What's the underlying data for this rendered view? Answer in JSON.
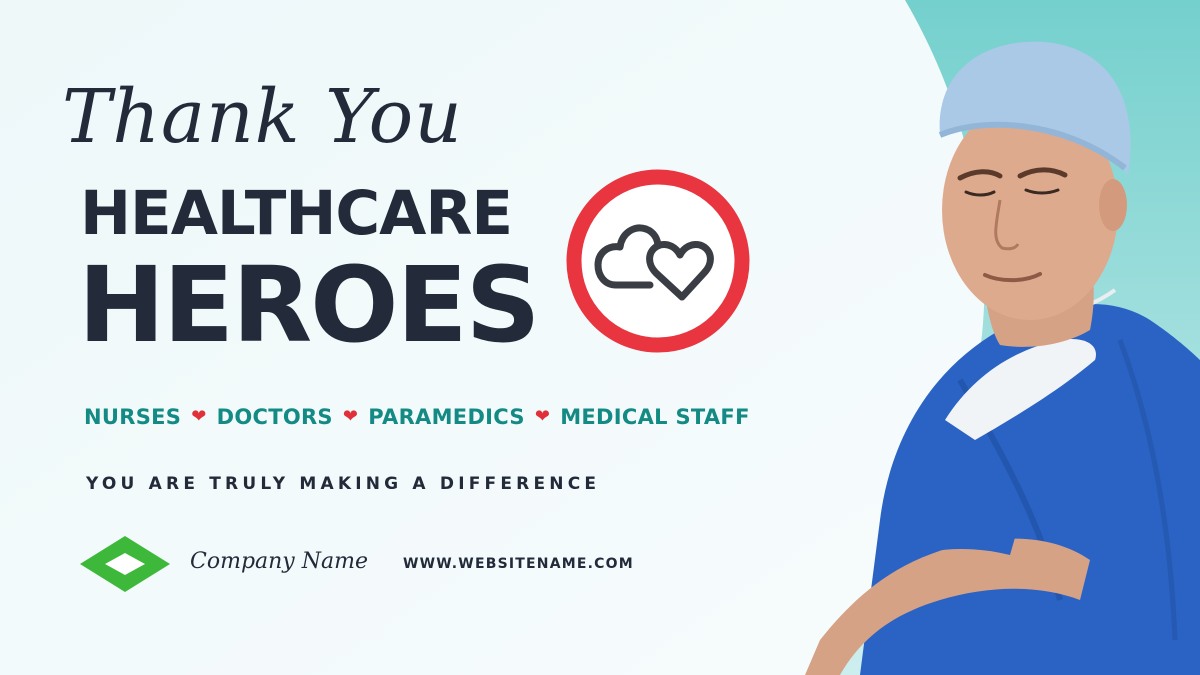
{
  "colors": {
    "background_left": "#f4fbfc",
    "background_right": "#8fd6d4",
    "text_dark": "#232b3b",
    "teal": "#138a84",
    "heart_red": "#e0303a",
    "badge_ring": "#e8353f",
    "logo_green": "#3db83a",
    "scrubs_blue": "#2a63c4"
  },
  "hero": {
    "script_title": "Thank You",
    "line2": "HEALTHCARE",
    "line3": "HEROES"
  },
  "badge": {
    "icon": "double-heart-icon"
  },
  "roles": {
    "items": [
      "NURSES",
      "DOCTORS",
      "PARAMEDICS",
      "MEDICAL STAFF"
    ],
    "separator_icon": "heart-icon"
  },
  "tagline": "YOU ARE TRULY MAKING A DIFFERENCE",
  "footer": {
    "logo_icon": "diamond-logo-icon",
    "company_name": "Company Name",
    "website": "WWW.WEBSITENAME.COM"
  },
  "photo": {
    "icon": "doctor-photo"
  }
}
